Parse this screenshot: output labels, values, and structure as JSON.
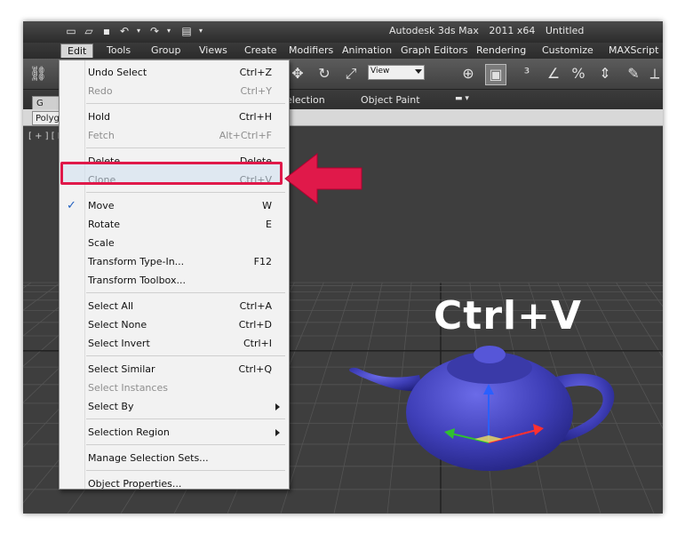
{
  "window": {
    "title_parts": [
      "Autodesk 3ds Max",
      "2011 x64",
      "Untitled"
    ]
  },
  "menubar": {
    "items": [
      "Edit",
      "Tools",
      "Group",
      "Views",
      "Create",
      "Modifiers",
      "Animation",
      "Graph Editors",
      "Rendering",
      "Customize",
      "MAXScript"
    ]
  },
  "toolbar": {
    "view_dropdown": "View"
  },
  "ribbon": {
    "left_tab": "G",
    "panel_tab": "Polyg",
    "tabs": [
      "election",
      "Object Paint"
    ]
  },
  "viewport": {
    "label": "[ + ] [ P",
    "overlay_text": "Ctrl+V"
  },
  "edit_menu": {
    "groups": [
      [
        {
          "label": "Undo Select",
          "shortcut": "Ctrl+Z",
          "enabled": true
        },
        {
          "label": "Redo",
          "shortcut": "Ctrl+Y",
          "enabled": false
        }
      ],
      [
        {
          "label": "Hold",
          "shortcut": "Ctrl+H",
          "enabled": true
        },
        {
          "label": "Fetch",
          "shortcut": "Alt+Ctrl+F",
          "enabled": false
        }
      ],
      [
        {
          "label": "Delete",
          "shortcut": "Delete",
          "enabled": true
        },
        {
          "label": "Clone",
          "shortcut": "Ctrl+V",
          "enabled": true
        }
      ],
      [
        {
          "label": "Move",
          "shortcut": "W",
          "enabled": true,
          "checked": true
        },
        {
          "label": "Rotate",
          "shortcut": "E",
          "enabled": true
        },
        {
          "label": "Scale",
          "shortcut": "",
          "enabled": true
        },
        {
          "label": "Transform Type-In...",
          "shortcut": "F12",
          "enabled": true
        },
        {
          "label": "Transform Toolbox...",
          "shortcut": "",
          "enabled": true
        }
      ],
      [
        {
          "label": "Select All",
          "shortcut": "Ctrl+A",
          "enabled": true
        },
        {
          "label": "Select None",
          "shortcut": "Ctrl+D",
          "enabled": true
        },
        {
          "label": "Select Invert",
          "shortcut": "Ctrl+I",
          "enabled": true
        }
      ],
      [
        {
          "label": "Select Similar",
          "shortcut": "Ctrl+Q",
          "enabled": true
        },
        {
          "label": "Select Instances",
          "shortcut": "",
          "enabled": false
        },
        {
          "label": "Select By",
          "shortcut": "",
          "enabled": true,
          "submenu": true
        }
      ],
      [
        {
          "label": "Selection Region",
          "shortcut": "",
          "enabled": true,
          "submenu": true
        }
      ],
      [
        {
          "label": "Manage Selection Sets...",
          "shortcut": "",
          "enabled": true
        }
      ],
      [
        {
          "label": "Object Properties...",
          "shortcut": "",
          "enabled": true
        }
      ]
    ]
  },
  "colors": {
    "highlight": "#e0194a",
    "teapot": "#3f3fb8",
    "viewport_bg": "#3e3e3e"
  }
}
